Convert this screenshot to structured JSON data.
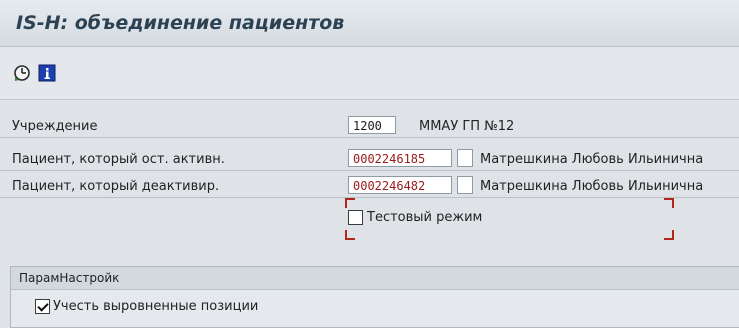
{
  "window": {
    "title": "IS-H: объединение пациентов"
  },
  "toolbar": {
    "execute_icon": "execute-clock-icon",
    "info_icon": "info-icon"
  },
  "form": {
    "institution": {
      "label": "Учреждение",
      "value": "1200",
      "description": "ММАУ ГП №12"
    },
    "patient_active": {
      "label": "Пациент, который ост. активн.",
      "value": "0002246185",
      "description": "Матрешкина Любовь Ильинична"
    },
    "patient_deactivate": {
      "label": "Пациент, который деактивир.",
      "value": "0002246482",
      "description": "Матрешкина Любовь Ильинична"
    },
    "test_mode": {
      "label": "Тестовый режим",
      "checked": false
    }
  },
  "settings_group": {
    "title": "ПарамНастройк",
    "consider_balanced": {
      "label": "Учесть выровненные позиции",
      "checked": true
    }
  },
  "colors": {
    "required_value": "#9a1b1b",
    "frame_marker": "#b3261e"
  }
}
